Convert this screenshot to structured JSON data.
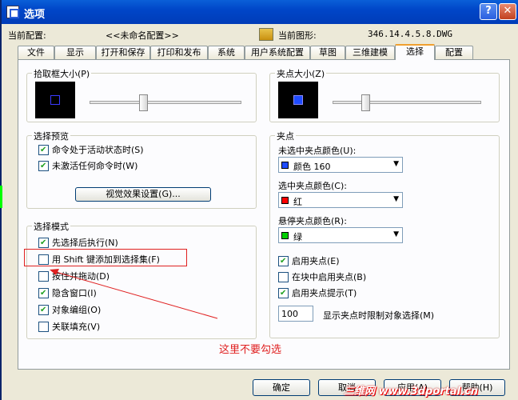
{
  "window": {
    "title": "选项",
    "help_glyph": "?",
    "close_glyph": "✕"
  },
  "header": {
    "config_label": "当前配置:",
    "config_value": "<<未命名配置>>",
    "drawing_label": "当前图形:",
    "drawing_value": "346.14.4.5.8.DWG"
  },
  "tabs": [
    "文件",
    "显示",
    "打开和保存",
    "打印和发布",
    "系统",
    "用户系统配置",
    "草图",
    "三维建模",
    "选择",
    "配置"
  ],
  "active_tab": "选择",
  "pickbox": {
    "title": "拾取框大小(P)",
    "slider_level": 0.45
  },
  "grip_size": {
    "title": "夹点大小(Z)",
    "slider_level": 0.2
  },
  "preview": {
    "title": "选择预览",
    "options": [
      {
        "label": "命令处于活动状态时(S)",
        "checked": true
      },
      {
        "label": "未激活任何命令时(W)",
        "checked": true
      }
    ],
    "button": "视觉效果设置(G)..."
  },
  "selection_modes": {
    "title": "选择模式",
    "options": [
      {
        "label": "先选择后执行(N)",
        "checked": true
      },
      {
        "label": "用 Shift 键添加到选择集(F)",
        "checked": false
      },
      {
        "label": "按住并拖动(D)",
        "checked": false
      },
      {
        "label": "隐含窗口(I)",
        "checked": true
      },
      {
        "label": "对象编组(O)",
        "checked": true
      },
      {
        "label": "关联填充(V)",
        "checked": false
      }
    ]
  },
  "grips": {
    "title": "夹点",
    "unselected_label": "未选中夹点颜色(U):",
    "unselected_value": "颜色 160",
    "unselected_color": "#1e4bff",
    "selected_label": "选中夹点颜色(C):",
    "selected_value": "红",
    "selected_color": "#ff0000",
    "hover_label": "悬停夹点颜色(R):",
    "hover_value": "绿",
    "hover_color": "#00d000",
    "options": [
      {
        "label": "启用夹点(E)",
        "checked": true
      },
      {
        "label": "在块中启用夹点(B)",
        "checked": false
      },
      {
        "label": "启用夹点提示(T)",
        "checked": true
      }
    ],
    "limit_value": "100",
    "limit_label": "显示夹点时限制对象选择(M)"
  },
  "annotation": {
    "text": "这里不要勾选"
  },
  "footer": {
    "ok": "确定",
    "cancel": "取消",
    "apply": "应用(A)",
    "help": "帮助(H)"
  },
  "watermark": "三维网 www.3dportal.cn"
}
